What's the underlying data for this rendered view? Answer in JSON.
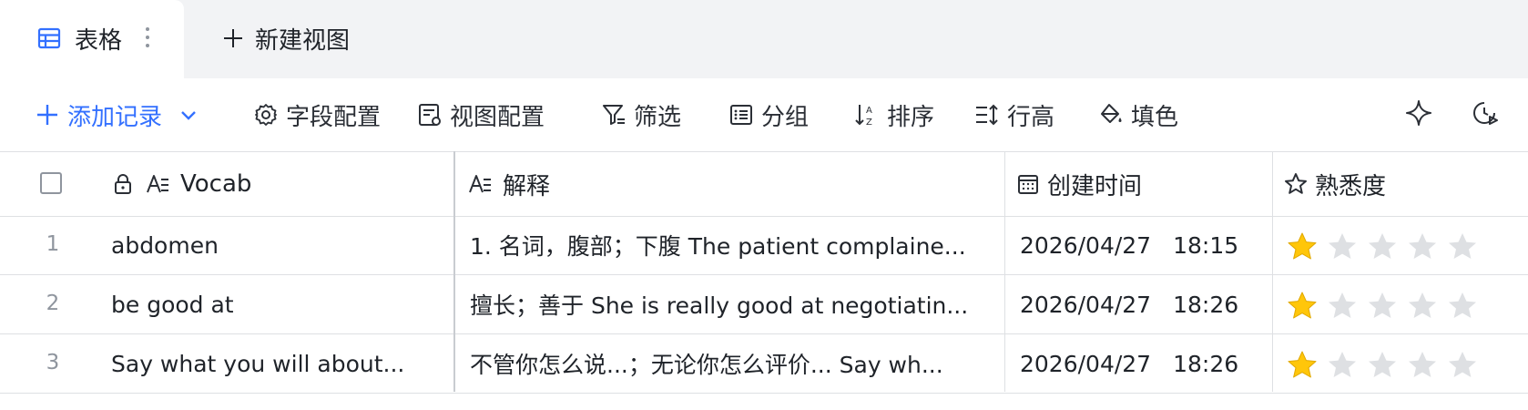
{
  "tabs": {
    "active_label": "表格",
    "new_view_label": "新建视图"
  },
  "toolbar": {
    "add_record": "添加记录",
    "field_config": "字段配置",
    "view_config": "视图配置",
    "filter": "筛选",
    "group": "分组",
    "sort": "排序",
    "row_height": "行高",
    "fill_color": "填色"
  },
  "table": {
    "columns": [
      "Vocab",
      "解释",
      "创建时间",
      "熟悉度"
    ],
    "rows": [
      {
        "num": "1",
        "vocab": "abdomen",
        "desc": "1. 名词，腹部；下腹 The patient complaine...",
        "date": "2026/04/27",
        "time": "18:15",
        "rating": 1
      },
      {
        "num": "2",
        "vocab": "be good at",
        "desc": "擅长；善于 She is really good at negotiatin...",
        "date": "2026/04/27",
        "time": "18:26",
        "rating": 1
      },
      {
        "num": "3",
        "vocab": "Say what you will about...",
        "desc": "不管你怎么说...；无论你怎么评价... Say wh...",
        "date": "2026/04/27",
        "time": "18:26",
        "rating": 1
      }
    ],
    "rating_max": 5
  },
  "colors": {
    "accent": "#3370ff",
    "star_on": "#ffc60a",
    "star_off": "#dee0e3"
  },
  "icons": [
    "grid-table-icon",
    "more-vertical-icon",
    "plus-icon",
    "chevron-down-icon",
    "gear-icon",
    "view-config-icon",
    "filter-icon",
    "group-icon",
    "sort-icon",
    "row-height-icon",
    "fill-color-icon",
    "sparkle-icon",
    "history-icon",
    "lock-icon",
    "text-field-icon",
    "calendar-icon",
    "star-icon"
  ]
}
